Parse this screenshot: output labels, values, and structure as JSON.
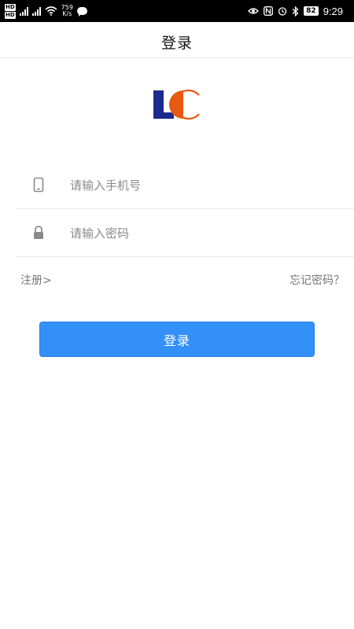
{
  "status_bar": {
    "hd_top": "HD",
    "hd_bottom": "HD",
    "net1": "5G",
    "net2": "4G",
    "speed_value": "759",
    "speed_unit": "K/s",
    "battery": "82",
    "time": "9:29"
  },
  "header": {
    "title": "登录"
  },
  "logo": {
    "letters": "LC",
    "colors": {
      "l": "#1b2a8f",
      "c": "#e85a12"
    }
  },
  "form": {
    "phone_placeholder": "请输入手机号",
    "phone_value": "",
    "password_placeholder": "请输入密码",
    "password_value": ""
  },
  "links": {
    "register": "注册>",
    "forgot": "忘记密码？"
  },
  "login_button": {
    "label": "登录",
    "color": "#3390f8"
  }
}
